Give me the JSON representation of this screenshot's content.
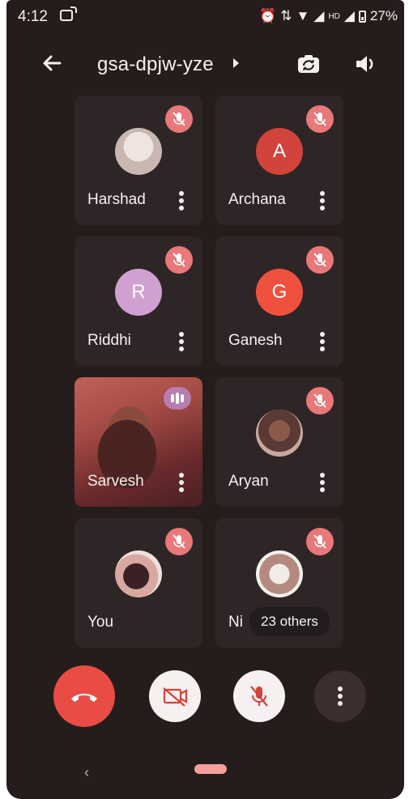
{
  "status_bar": {
    "time": "4:12",
    "hd": "HD",
    "battery": "27%"
  },
  "app_bar": {
    "meeting_code": "gsa-dpjw-yze"
  },
  "participants": [
    {
      "name": "Harshad",
      "avatar": "photo",
      "muted": true
    },
    {
      "name": "Archana",
      "avatar_letter": "A",
      "avatar_color": "#d2433c",
      "muted": true
    },
    {
      "name": "Riddhi",
      "avatar_letter": "R",
      "avatar_color": "#cfa0d0",
      "muted": true
    },
    {
      "name": "Ganesh",
      "avatar_letter": "G",
      "avatar_color": "#f0503e",
      "muted": true
    },
    {
      "name": "Sarvesh",
      "avatar": "video",
      "muted": false,
      "speaking": true
    },
    {
      "name": "Aryan",
      "avatar": "photo",
      "muted": true
    },
    {
      "name": "You",
      "avatar": "photo",
      "muted": true
    },
    {
      "name": "Ni",
      "avatar": "photo",
      "muted": true
    }
  ],
  "others_label": "23 others",
  "controls": {
    "end_call_color": "#e84c44",
    "accent_mute": "#e8787a"
  }
}
